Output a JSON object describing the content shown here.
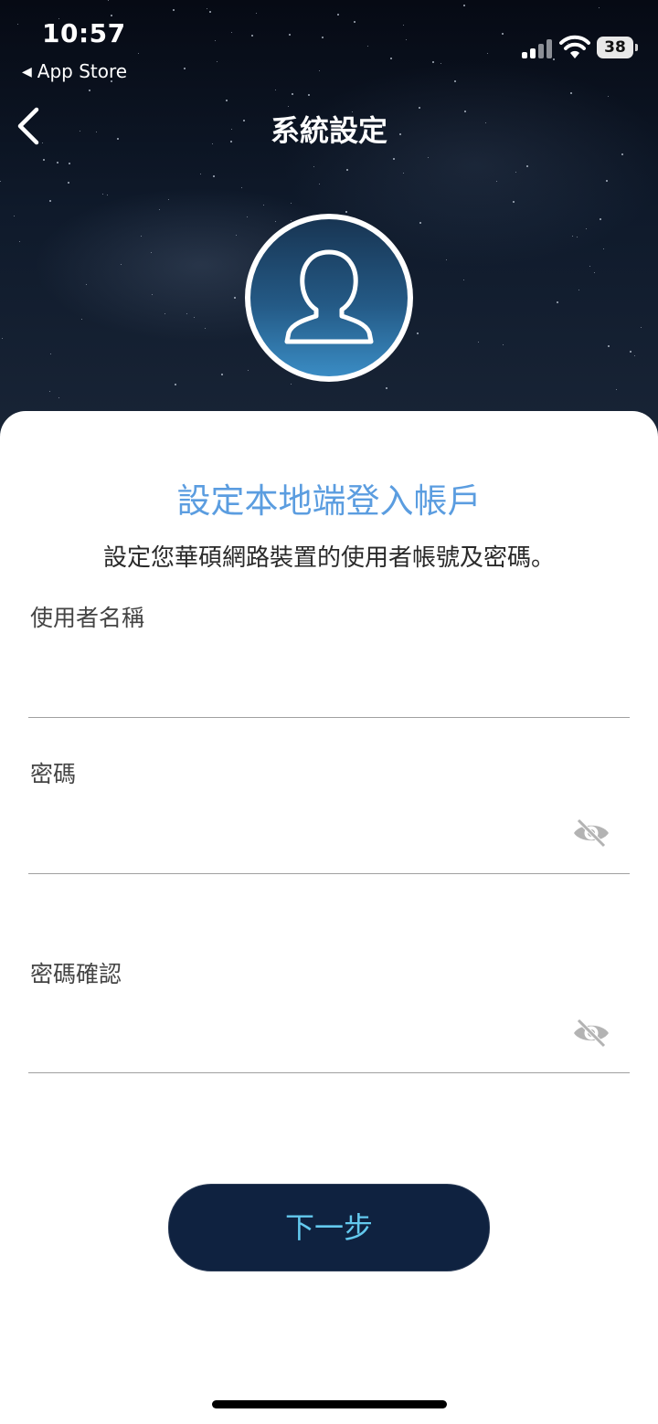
{
  "status_bar": {
    "time": "10:57",
    "back_app": "App Store",
    "battery": "38"
  },
  "nav": {
    "title": "系統設定"
  },
  "form": {
    "title": "設定本地端登入帳戶",
    "subtitle": "設定您華碩網路裝置的使用者帳號及密碼。",
    "username_label": "使用者名稱",
    "username_value": "",
    "password_label": "密碼",
    "password_value": "",
    "confirm_label": "密碼確認",
    "confirm_value": ""
  },
  "actions": {
    "next_label": "下一步"
  },
  "colors": {
    "title_blue": "#5b9de0",
    "button_bg": "#0f2240",
    "button_text": "#63c9ee"
  },
  "icons": [
    "chevron-left-icon",
    "user-avatar-icon",
    "eye-slash-icon",
    "signal-icon",
    "wifi-icon",
    "battery-icon"
  ]
}
